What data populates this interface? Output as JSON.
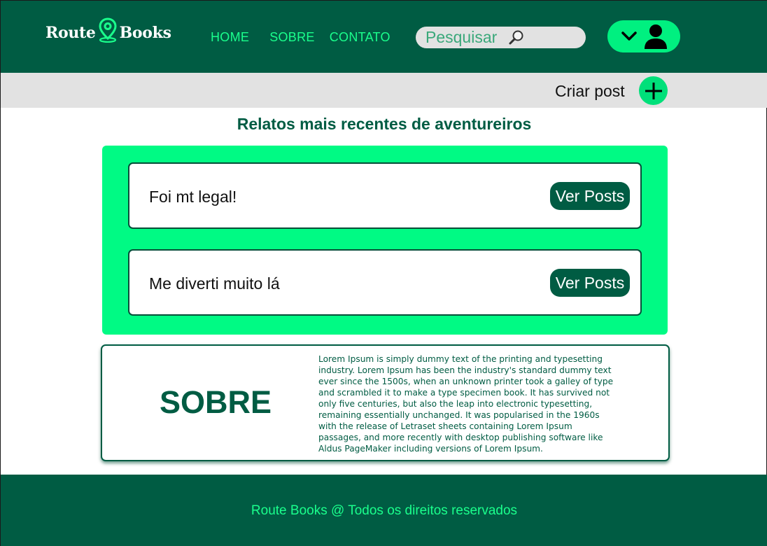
{
  "header": {
    "logo": {
      "left": "Route",
      "right": "Books",
      "icon": "map-pin-icon"
    },
    "nav": [
      {
        "label": "HOME"
      },
      {
        "label": "SOBRE"
      },
      {
        "label": "CONTATO"
      }
    ],
    "search": {
      "placeholder": "Pesquisar",
      "icon": "search-icon"
    },
    "user_menu": {
      "icons": [
        "chevron-down-icon",
        "user-icon"
      ]
    }
  },
  "subbar": {
    "create_label": "Criar post",
    "create_icon": "plus-icon"
  },
  "main": {
    "section_title": "Relatos mais recentes de aventureiros",
    "posts": [
      {
        "text": "Foi mt legal!",
        "button": "Ver Posts"
      },
      {
        "text": "Me diverti muito lá",
        "button": "Ver Posts"
      }
    ]
  },
  "about": {
    "title": "SOBRE",
    "body": "Lorem Ipsum is simply dummy text of the printing and typesetting industry. Lorem Ipsum has been the industry's standard dummy text ever since the 1500s, when an unknown printer took a galley of type and scrambled it to make a type specimen book. It has survived not only five centuries, but also the leap into electronic typesetting, remaining essentially unchanged. It was popularised in the 1960s with the release of Letraset sheets containing Lorem Ipsum passages, and more recently with desktop publishing software like Aldus PageMaker including versions of Lorem Ipsum."
  },
  "footer": {
    "text": "Route Books @ Todos os direitos reservados"
  },
  "colors": {
    "primary_dark": "#005c43",
    "accent_green": "#00fa84",
    "nav_text": "#1aff8c",
    "bar_gray": "#e2e2e2"
  }
}
